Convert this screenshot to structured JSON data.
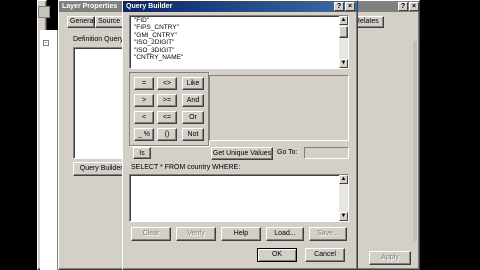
{
  "layer_properties": {
    "title": "Layer Properties",
    "tabs": [
      "General",
      "Source",
      "Relates"
    ],
    "definition_query_label": "Definition Query:",
    "query_builder_button": "Query Builder...",
    "apply_button": "Apply"
  },
  "query_builder": {
    "title": "Query Builder",
    "fields": [
      "\"FID\"",
      "\"FIPS_CNTRY\"",
      "\"GMI_CNTRY\"",
      "\"ISO_2DIGIT\"",
      "\"ISO_3DIGIT\"",
      "\"CNTRY_NAME\""
    ],
    "operators": [
      [
        "=",
        "<>",
        "Like"
      ],
      [
        ">",
        ">=",
        "And"
      ],
      [
        "<",
        "<=",
        "Or"
      ],
      [
        "_ %",
        "()",
        "Not"
      ]
    ],
    "is_button": "Is",
    "get_unique_values_button": "Get Unique Values",
    "go_to_label": "Go To:",
    "select_statement": "SELECT * FROM country WHERE:",
    "bottom_buttons": {
      "clear": "Clear",
      "verify": "Verify",
      "help": "Help",
      "load": "Load...",
      "save": "Save..."
    },
    "ok_button": "OK",
    "cancel_button": "Cancel"
  },
  "colors": {
    "title_active": "#0a246a",
    "title_inactive": "#808080",
    "face": "#d4d0c8"
  }
}
